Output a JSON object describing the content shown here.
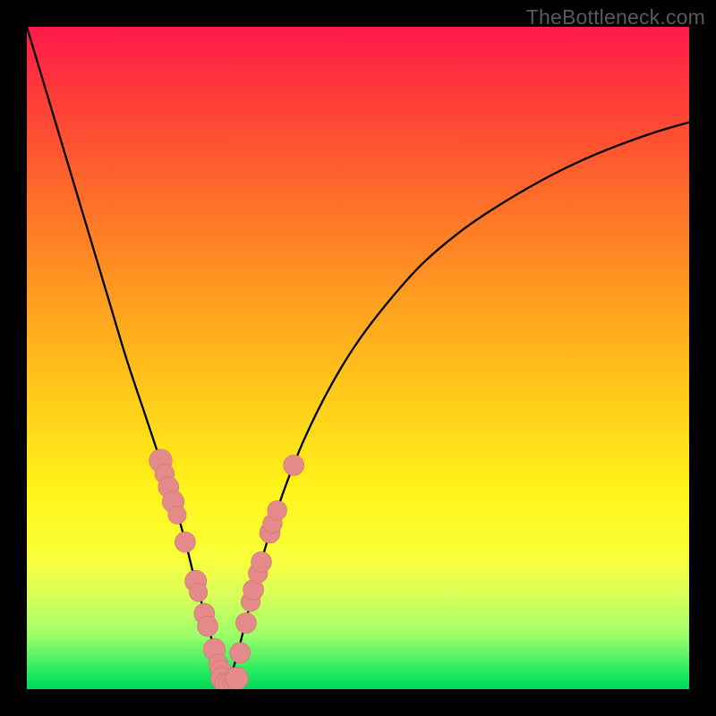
{
  "watermark": "TheBottleneck.com",
  "colors": {
    "curve": "#000000",
    "marker_fill": "#e58a8a",
    "marker_stroke": "#d07272",
    "plot_border": "#000000"
  },
  "chart_data": {
    "type": "line",
    "title": "",
    "xlabel": "",
    "ylabel": "",
    "xlim": [
      0,
      100
    ],
    "ylim": [
      0,
      100
    ],
    "series": [
      {
        "name": "bottleneck-curve",
        "x": [
          0,
          3,
          6,
          9,
          12,
          15,
          18,
          20,
          22,
          24,
          25.5,
          27,
          28.3,
          29.2,
          30,
          30.8,
          31.7,
          33,
          34.5,
          36.5,
          39,
          42,
          46,
          50,
          55,
          60,
          66,
          72,
          79,
          86,
          94,
          100
        ],
        "y": [
          100,
          90,
          80,
          70,
          60,
          50,
          41,
          35,
          29,
          22,
          16,
          11,
          6,
          3,
          0.5,
          2,
          5,
          10,
          16,
          23,
          30.5,
          38,
          46,
          52.5,
          59,
          64.5,
          69.5,
          73.5,
          77.5,
          80.8,
          83.8,
          85.6
        ]
      }
    ],
    "markers": {
      "name": "highlight-points",
      "points": [
        {
          "x": 20.2,
          "y": 34.5,
          "r": 1.4
        },
        {
          "x": 20.8,
          "y": 32.5,
          "r": 1.1
        },
        {
          "x": 21.4,
          "y": 30.5,
          "r": 1.2
        },
        {
          "x": 22.1,
          "y": 28.3,
          "r": 1.3
        },
        {
          "x": 22.7,
          "y": 26.3,
          "r": 1.0
        },
        {
          "x": 23.9,
          "y": 22.2,
          "r": 1.2
        },
        {
          "x": 25.5,
          "y": 16.3,
          "r": 1.3
        },
        {
          "x": 25.9,
          "y": 14.6,
          "r": 1.0
        },
        {
          "x": 26.8,
          "y": 11.4,
          "r": 1.2
        },
        {
          "x": 27.3,
          "y": 9.5,
          "r": 1.2
        },
        {
          "x": 28.3,
          "y": 6.0,
          "r": 1.3
        },
        {
          "x": 28.9,
          "y": 3.8,
          "r": 1.1
        },
        {
          "x": 29.3,
          "y": 2.8,
          "r": 1.2
        },
        {
          "x": 29.5,
          "y": 1.6,
          "r": 1.4
        },
        {
          "x": 30.0,
          "y": 0.8,
          "r": 1.3
        },
        {
          "x": 30.6,
          "y": 0.8,
          "r": 1.3
        },
        {
          "x": 31.2,
          "y": 1.0,
          "r": 1.2
        },
        {
          "x": 31.7,
          "y": 1.6,
          "r": 1.4
        },
        {
          "x": 32.2,
          "y": 5.5,
          "r": 1.2
        },
        {
          "x": 33.1,
          "y": 10.0,
          "r": 1.2
        },
        {
          "x": 33.8,
          "y": 13.2,
          "r": 1.1
        },
        {
          "x": 34.2,
          "y": 15.0,
          "r": 1.2
        },
        {
          "x": 34.9,
          "y": 17.5,
          "r": 1.1
        },
        {
          "x": 35.4,
          "y": 19.2,
          "r": 1.2
        },
        {
          "x": 36.7,
          "y": 23.6,
          "r": 1.2
        },
        {
          "x": 37.1,
          "y": 25.0,
          "r": 1.1
        },
        {
          "x": 37.8,
          "y": 27.0,
          "r": 1.1
        },
        {
          "x": 40.3,
          "y": 33.8,
          "r": 1.2
        }
      ]
    }
  }
}
